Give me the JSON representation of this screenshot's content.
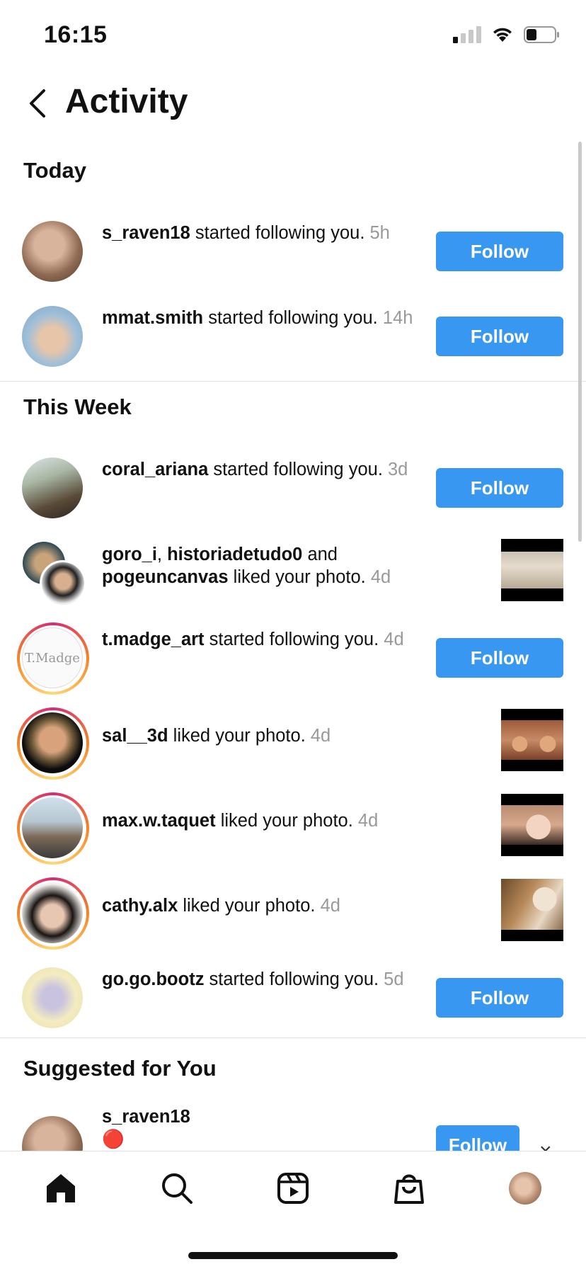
{
  "status": {
    "time": "16:15",
    "signal_bars_on": 1,
    "battery_level": 0.3
  },
  "header": {
    "back_icon": "chevron-left-icon",
    "title": "Activity"
  },
  "sections": {
    "today": "Today",
    "this_week": "This Week",
    "suggested": "Suggested for You"
  },
  "today_items": [
    {
      "user": "s_raven18",
      "text": " started following you. ",
      "time": "5h",
      "action": "Follow"
    },
    {
      "user": "mmat.smith",
      "text": " started following you. ",
      "time": "14h",
      "action": "Follow"
    }
  ],
  "week_items": [
    {
      "user": "coral_ariana",
      "text": " started following you. ",
      "time": "3d",
      "action": "Follow"
    },
    {
      "users": [
        "goro_i",
        "historiadetudo0",
        "pogeuncanvas"
      ],
      "sep1": ", ",
      "sep2": " and ",
      "text": " liked your photo. ",
      "time": "4d"
    },
    {
      "user": "t.madge_art",
      "text": " started following you. ",
      "time": "4d",
      "action": "Follow",
      "avatar_text": "T.Madge"
    },
    {
      "user": "sal__3d",
      "text": " liked your photo. ",
      "time": "4d"
    },
    {
      "user": "max.w.taquet",
      "text": " liked your photo. ",
      "time": "4d"
    },
    {
      "user": "cathy.alx",
      "text": " liked your photo. ",
      "time": "4d"
    },
    {
      "user": "go.go.bootz",
      "text": " started following you. ",
      "time": "5d",
      "action": "Follow"
    }
  ],
  "suggested_items": [
    {
      "user": "s_raven18",
      "subtitle": "🔴",
      "action": "Follow",
      "dismiss": "×"
    }
  ],
  "tab_bar": {
    "icons": [
      "home-icon",
      "search-icon",
      "reels-icon",
      "shop-icon",
      "profile-avatar"
    ]
  },
  "colors": {
    "follow_button": "#3897f0",
    "timestamp": "#999999",
    "story_ring_start": "#d62976",
    "story_ring_end": "#f58529"
  }
}
